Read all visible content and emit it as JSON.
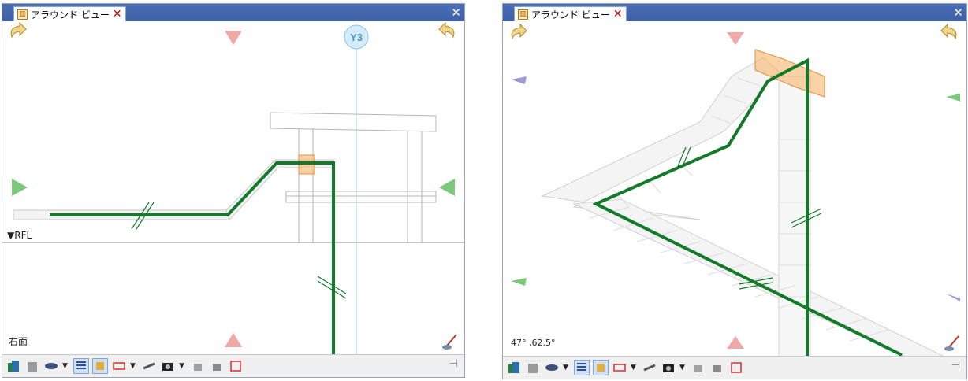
{
  "left_panel": {
    "tab_title": "アラウンド ビュー",
    "level_label": "▼RFL",
    "grid_label": "Y3",
    "view_label": "右面"
  },
  "right_panel": {
    "tab_title": "アラウンド ビュー",
    "angle_label": "47°  ,62.5°"
  },
  "toolbar_icons": [
    "building-icon",
    "building-gray-icon",
    "eye-icon",
    "dropdown",
    "filter-icon",
    "tool-icon",
    "rectangle-icon",
    "dropdown",
    "brush-icon",
    "camera-icon",
    "dropdown",
    "export-icon",
    "import-icon",
    "settings-icon"
  ],
  "colors": {
    "title_bar": "#3d5fa6",
    "route": "#137a2b",
    "triangle_red": "#f0a8a8",
    "triangle_green": "#7cc97c",
    "triangle_blue": "#9b9bd8",
    "highlight_box": "#f6b46a"
  }
}
